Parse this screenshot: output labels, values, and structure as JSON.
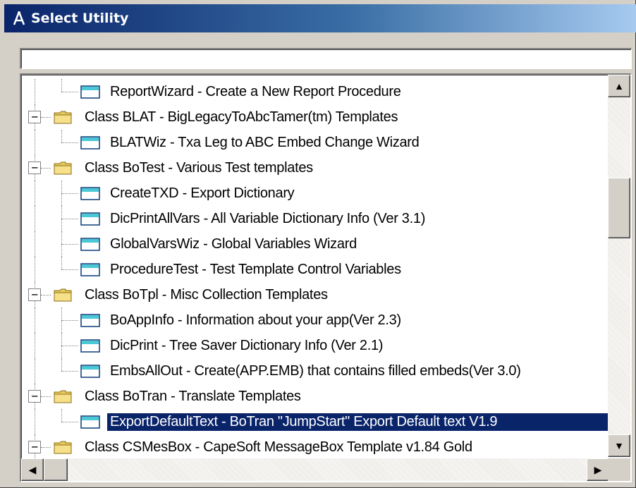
{
  "window": {
    "title": "Select Utility",
    "title_icon": "utility-wand-icon"
  },
  "locator": {
    "value": ""
  },
  "tree": {
    "items": [
      {
        "type": "child",
        "label": "ReportWizard - Create a New Report Procedure",
        "last": true,
        "icon": "template-icon"
      },
      {
        "type": "parent",
        "label": "Class BLAT - BigLegacyToAbcTamer(tm) Templates",
        "expanded": true,
        "icon": "folder-icon"
      },
      {
        "type": "child",
        "label": "BLATWiz - Txa Leg to ABC Embed Change Wizard",
        "last": true,
        "icon": "template-icon"
      },
      {
        "type": "parent",
        "label": "Class BoTest - Various Test templates",
        "expanded": true,
        "icon": "folder-icon"
      },
      {
        "type": "child",
        "label": "CreateTXD - Export Dictionary",
        "last": false,
        "icon": "template-icon"
      },
      {
        "type": "child",
        "label": "DicPrintAllVars - All Variable Dictionary Info (Ver 3.1)",
        "last": false,
        "icon": "template-icon"
      },
      {
        "type": "child",
        "label": "GlobalVarsWiz - Global Variables Wizard",
        "last": false,
        "icon": "template-icon"
      },
      {
        "type": "child",
        "label": "ProcedureTest - Test Template Control Variables",
        "last": true,
        "icon": "template-icon"
      },
      {
        "type": "parent",
        "label": "Class BoTpl - Misc Collection Templates",
        "expanded": true,
        "icon": "folder-icon"
      },
      {
        "type": "child",
        "label": "BoAppInfo - Information about your app(Ver 2.3)",
        "last": false,
        "icon": "template-icon"
      },
      {
        "type": "child",
        "label": "DicPrint - Tree Saver Dictionary Info (Ver 2.1)",
        "last": false,
        "icon": "template-icon"
      },
      {
        "type": "child",
        "label": "EmbsAllOut - Create(APP.EMB) that contains filled embeds(Ver 3.0)",
        "last": true,
        "icon": "template-icon"
      },
      {
        "type": "parent",
        "label": "Class BoTran -  Translate Templates",
        "expanded": true,
        "icon": "folder-icon"
      },
      {
        "type": "child",
        "label": "ExportDefaultText - BoTran \"JumpStart\" Export Default text V1.9",
        "last": true,
        "selected": true,
        "icon": "template-icon"
      },
      {
        "type": "parent",
        "label": "Class CSMesBox - CapeSoft MessageBox Template v1.84 Gold",
        "expanded": true,
        "icon": "folder-icon"
      }
    ]
  },
  "scrollbars": {
    "up_arrow": "▲",
    "down_arrow": "▼",
    "left_arrow": "◀",
    "right_arrow": "▶",
    "vertical_position": 0.3,
    "horizontal_position": 0.0
  },
  "colors": {
    "selection": "#0a246a",
    "titlebar_start": "#0a246a",
    "leaf_icon": "#4bc8d6",
    "folder": "#e8cb5a"
  }
}
